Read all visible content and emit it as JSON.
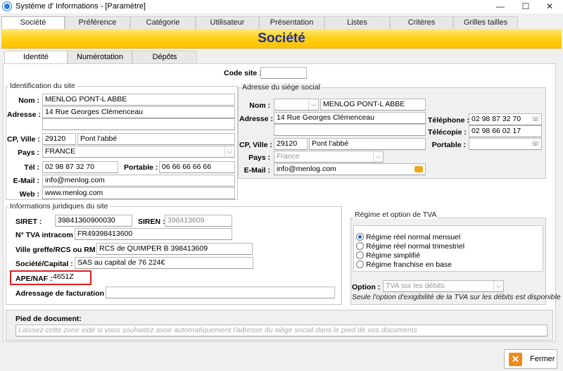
{
  "window": {
    "title": "Système d' Informations - [Paramètre]",
    "minimize": "—",
    "maximize": "☐",
    "close": "✕"
  },
  "main_tabs": [
    "Société",
    "Préférence",
    "Catégorie",
    "Utilisateur",
    "Présentation",
    "Listes",
    "Critères",
    "Grilles tailles"
  ],
  "banner_title": "Société",
  "sub_tabs": [
    "Identité",
    "Numérotation",
    "Dépôts"
  ],
  "code_site": {
    "label": "Code site :",
    "value": ""
  },
  "site": {
    "legend": "Identification du site",
    "nom_label": "Nom :",
    "nom": "MENLOG PONT-L ABBE",
    "adresse_label": "Adresse :",
    "adresse1": "14 Rue Georges Clémenceau",
    "adresse2": "",
    "cp_ville_label": "CP, Ville :",
    "cp": "29120",
    "ville": "Pont l'abbé",
    "pays_label": "Pays :",
    "pays": "FRANCE",
    "tel_label": "Tél :",
    "tel": "02 98 87 32 70",
    "portable_label": "Portable :",
    "portable": "06 66 66 66 66",
    "email_label": "E-Mail :",
    "email": "info@menlog.com",
    "web_label": "Web :",
    "web": "www.menlog.com"
  },
  "siege": {
    "legend": "Adresse du siège social",
    "nom_label": "Nom :",
    "civilite": "",
    "nom": "MENLOG PONT-L ABBE",
    "adresse_label": "Adresse :",
    "adresse1": "14 Rue Georges Clémenceau",
    "adresse2": "",
    "telephone_label": "Téléphone :",
    "telephone": "02 98 87 32 70",
    "telecopie_label": "Télécopie :",
    "telecopie": "02 98 66 02 17",
    "cp_ville_label": "CP, Ville :",
    "cp": "29120",
    "ville": "Pont l'abbé",
    "portable_label": "Portable :",
    "portable": "",
    "pays_label": "Pays :",
    "pays": "France",
    "email_label": "E-Mail :",
    "email": "info@menlog.com"
  },
  "juridique": {
    "legend": "Informations juridiques du site",
    "siret_label": "SIRET :",
    "siret": "39841360900030",
    "siren_label": "SIREN :",
    "siren": "398413609",
    "tva_label": "N° TVA intracom :",
    "tva": "FR49398413600",
    "greffe_label": "Ville greffe/RCS ou RM :",
    "greffe": "RCS de QUIMPER B 398413609",
    "societe_label": "Société/Capital :",
    "societe": "SAS au capital de 76 224€",
    "ape_label": "APE/NAF :",
    "ape": "4651Z",
    "facturation_label": "Adressage de facturation :",
    "facturation": ""
  },
  "regime": {
    "legend": "Régime et option de TVA",
    "options": [
      "Régime réel normal mensuel",
      "Régime réel normal trimestriel",
      "Régime simplifié",
      "Régime franchise en base"
    ],
    "option_label": "Option :",
    "option_value": "TVA sur les débits",
    "note": "Seule l'option d'exigibilité de la TVA sur les débits est disponible"
  },
  "pied": {
    "label": "Pied de document:",
    "placeholder": "Laissez cette zone vide si vous souhaitez avoir automatiquement l'adresse du siège social dans le pied de vos documents"
  },
  "close_label": "Fermer"
}
